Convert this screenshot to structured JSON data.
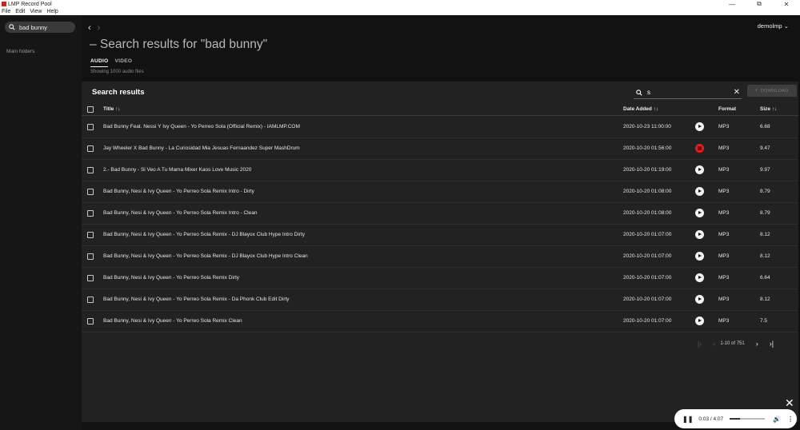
{
  "window": {
    "title": "LMP Record Pool",
    "minimize": "—",
    "maximize": "⧉",
    "close": "✕"
  },
  "menu": [
    "File",
    "Edit",
    "View",
    "Help"
  ],
  "sidebar": {
    "search_value": "bad bunny",
    "folders_label": "Main folders"
  },
  "header": {
    "user": "demolmp",
    "title": "– Search results for \"bad bunny\""
  },
  "tabs": [
    {
      "label": "AUDIO",
      "active": true
    },
    {
      "label": "VIDEO",
      "active": false
    }
  ],
  "showing": "Showing 1000 audio files",
  "results": {
    "title": "Search results",
    "filter_value": "s",
    "download_label": "DOWNLOAD",
    "columns": {
      "title": "Title ↑↓",
      "date": "Date Added ↑↓",
      "format": "Format",
      "size": "Size ↑↓"
    },
    "rows": [
      {
        "title": "Bad Bunny Feat. Nessi Y Ivy Queen - Yo Perreo Sola (Official Remix) - IAMLMP.COM",
        "date": "2020-10-23 11:00:00",
        "format": "MP3",
        "size": "6.68"
      },
      {
        "title": "Jay Wheeler X Bad Bunny - La Curiosidad Mia Jesuas Fernaandez Super MashDrum",
        "date": "2020-10-20 01:56:00",
        "format": "MP3",
        "size": "9.47",
        "playing": true
      },
      {
        "title": "2.- Bad Bunny - Si Veo A Tu Mama Mixer Kaos Love Music 2020",
        "date": "2020-10-20 01:19:00",
        "format": "MP3",
        "size": "9.97"
      },
      {
        "title": "Bad Bunny, Nesi & Ivy Queen - Yo Perreo Sola Remix Intro - Dirty",
        "date": "2020-10-20 01:08:00",
        "format": "MP3",
        "size": "8.79"
      },
      {
        "title": "Bad Bunny, Nesi & Ivy Queen - Yo Perreo Sola Remix Intro - Clean",
        "date": "2020-10-20 01:08:00",
        "format": "MP3",
        "size": "8.79"
      },
      {
        "title": "Bad Bunny, Nesi & Ivy Queen - Yo Perreo Sola Remix - DJ Blayox Club Hype Intro Dirty",
        "date": "2020-10-20 01:07:00",
        "format": "MP3",
        "size": "8.12"
      },
      {
        "title": "Bad Bunny, Nesi & Ivy Queen - Yo Perreo Sola Remix - DJ Blayox Club Hype Intro Clean",
        "date": "2020-10-20 01:07:00",
        "format": "MP3",
        "size": "8.12"
      },
      {
        "title": "Bad Bunny, Nesi & Ivy Queen - Yo Perreo Sola Remix Dirty",
        "date": "2020-10-20 01:07:00",
        "format": "MP3",
        "size": "6.64"
      },
      {
        "title": "Bad Bunny, Nesi & Ivy Queen - Yo Perreo Sola Remix - Da Phonk Club Edit Dirty",
        "date": "2020-10-20 01:07:00",
        "format": "MP3",
        "size": "8.12"
      },
      {
        "title": "Bad Bunny, Nesi & Ivy Queen - Yo Perreo Sola Remix Clean",
        "date": "2020-10-20 01:07:00",
        "format": "MP3",
        "size": "7.5"
      }
    ],
    "pagination": "1-10 of 751"
  },
  "player": {
    "time": "0:03 / 4:07",
    "progress": 0.3
  },
  "colors": {
    "accent": "#e02020",
    "panel": "#222222",
    "background": "#121212"
  }
}
